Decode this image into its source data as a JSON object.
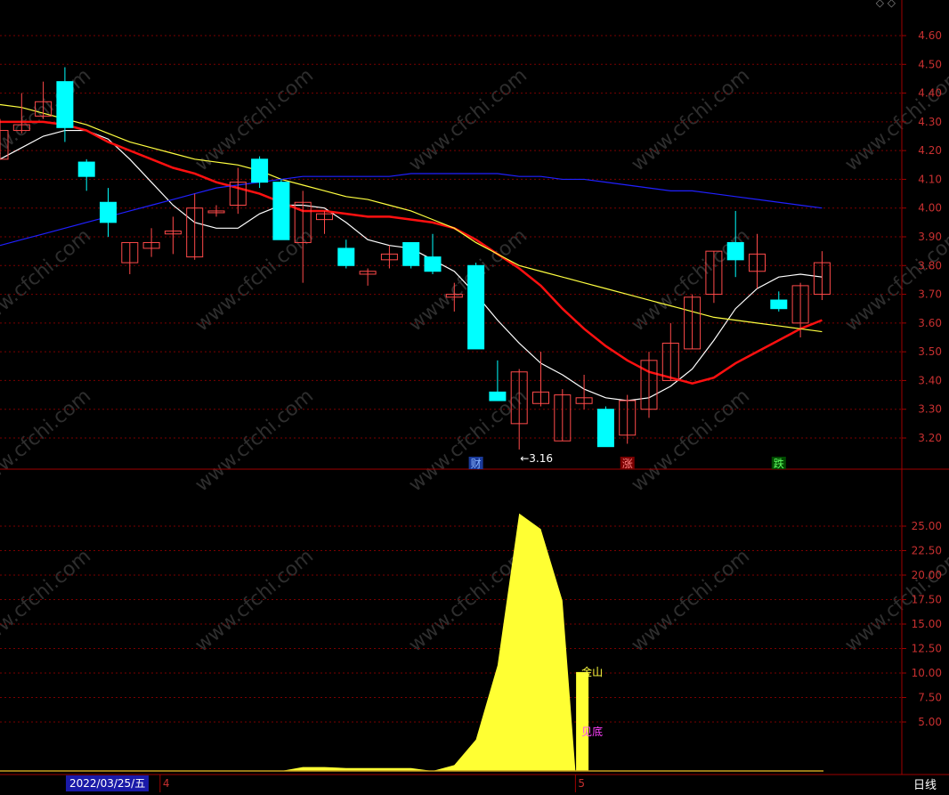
{
  "colors": {
    "background": "#000000",
    "grid": "#7a0000",
    "axis": "#a00000",
    "axis_text": "#c83030",
    "up_candle": "#ff4a4a",
    "down_candle": "#00ffff",
    "ma_white": "#ffffff",
    "ma_red": "#ff1010",
    "ma_yellow": "#ffff40",
    "ma_blue": "#2020ff",
    "indicator_fill": "#ffff33",
    "watermark": "#333333"
  },
  "watermark_text": "www.cfchi.com",
  "period_label": "日线",
  "date_badge": "2022/03/25/五",
  "top_icons": "◇ ◇",
  "chart_data": [
    {
      "type": "candlestick",
      "ylim": [
        3.08,
        4.68
      ],
      "y_ticks": [
        "4.60",
        "4.50",
        "4.40",
        "4.30",
        "4.20",
        "4.10",
        "4.00",
        "3.90",
        "3.80",
        "3.70",
        "3.60",
        "3.50",
        "3.40",
        "3.30",
        "3.20"
      ],
      "grid": true,
      "candles": [
        {
          "o": 4.17,
          "c": 4.27,
          "h": 4.31,
          "l": 4.17
        },
        {
          "o": 4.27,
          "c": 4.29,
          "h": 4.4,
          "l": 4.26
        },
        {
          "o": 4.32,
          "c": 4.37,
          "h": 4.44,
          "l": 4.31
        },
        {
          "o": 4.44,
          "c": 4.28,
          "h": 4.49,
          "l": 4.23
        },
        {
          "o": 4.16,
          "c": 4.11,
          "h": 4.17,
          "l": 4.06
        },
        {
          "o": 4.02,
          "c": 3.95,
          "h": 4.07,
          "l": 3.9
        },
        {
          "o": 3.81,
          "c": 3.88,
          "h": 3.88,
          "l": 3.77
        },
        {
          "o": 3.86,
          "c": 3.88,
          "h": 3.93,
          "l": 3.83
        },
        {
          "o": 3.91,
          "c": 3.92,
          "h": 3.97,
          "l": 3.84
        },
        {
          "o": 3.83,
          "c": 4.0,
          "h": 4.05,
          "l": 3.82
        },
        {
          "o": 3.99,
          "c": 3.99,
          "h": 4.01,
          "l": 3.97
        },
        {
          "o": 4.01,
          "c": 4.09,
          "h": 4.14,
          "l": 3.98
        },
        {
          "o": 4.17,
          "c": 4.09,
          "h": 4.18,
          "l": 4.07
        },
        {
          "o": 4.09,
          "c": 3.89,
          "h": 4.1,
          "l": 3.89
        },
        {
          "o": 3.88,
          "c": 4.02,
          "h": 4.06,
          "l": 3.74
        },
        {
          "o": 3.96,
          "c": 3.98,
          "h": 3.99,
          "l": 3.91
        },
        {
          "o": 3.86,
          "c": 3.8,
          "h": 3.89,
          "l": 3.79
        },
        {
          "o": 3.77,
          "c": 3.78,
          "h": 3.79,
          "l": 3.73
        },
        {
          "o": 3.82,
          "c": 3.84,
          "h": 3.87,
          "l": 3.79
        },
        {
          "o": 3.88,
          "c": 3.8,
          "h": 3.88,
          "l": 3.79
        },
        {
          "o": 3.83,
          "c": 3.78,
          "h": 3.91,
          "l": 3.77
        },
        {
          "o": 3.69,
          "c": 3.7,
          "h": 3.74,
          "l": 3.64
        },
        {
          "o": 3.8,
          "c": 3.51,
          "h": 3.81,
          "l": 3.51
        },
        {
          "o": 3.36,
          "c": 3.33,
          "h": 3.47,
          "l": 3.33
        },
        {
          "o": 3.25,
          "c": 3.43,
          "h": 3.44,
          "l": 3.16
        },
        {
          "o": 3.32,
          "c": 3.36,
          "h": 3.5,
          "l": 3.31
        },
        {
          "o": 3.19,
          "c": 3.35,
          "h": 3.37,
          "l": 3.19
        },
        {
          "o": 3.32,
          "c": 3.34,
          "h": 3.42,
          "l": 3.3
        },
        {
          "o": 3.3,
          "c": 3.17,
          "h": 3.31,
          "l": 3.17
        },
        {
          "o": 3.21,
          "c": 3.33,
          "h": 3.35,
          "l": 3.18
        },
        {
          "o": 3.3,
          "c": 3.47,
          "h": 3.5,
          "l": 3.27
        },
        {
          "o": 3.4,
          "c": 3.53,
          "h": 3.6,
          "l": 3.4
        },
        {
          "o": 3.51,
          "c": 3.69,
          "h": 3.7,
          "l": 3.51
        },
        {
          "o": 3.7,
          "c": 3.85,
          "h": 3.85,
          "l": 3.67
        },
        {
          "o": 3.88,
          "c": 3.82,
          "h": 3.99,
          "l": 3.76
        },
        {
          "o": 3.78,
          "c": 3.84,
          "h": 3.91,
          "l": 3.72
        },
        {
          "o": 3.68,
          "c": 3.65,
          "h": 3.71,
          "l": 3.64
        },
        {
          "o": 3.6,
          "c": 3.73,
          "h": 3.74,
          "l": 3.55
        },
        {
          "o": 3.7,
          "c": 3.81,
          "h": 3.85,
          "l": 3.68
        }
      ],
      "moving_averages": [
        {
          "color": "ma_white",
          "values": [
            4.17,
            4.21,
            4.25,
            4.27,
            4.27,
            4.24,
            4.17,
            4.09,
            4.01,
            3.95,
            3.93,
            3.93,
            3.98,
            4.01,
            4.01,
            4.0,
            3.95,
            3.89,
            3.87,
            3.86,
            3.82,
            3.78,
            3.7,
            3.61,
            3.53,
            3.46,
            3.42,
            3.37,
            3.34,
            3.33,
            3.34,
            3.38,
            3.44,
            3.54,
            3.65,
            3.72,
            3.76,
            3.77,
            3.76
          ]
        },
        {
          "color": "ma_red",
          "values": [
            4.3,
            4.3,
            4.3,
            4.29,
            4.27,
            4.23,
            4.2,
            4.17,
            4.14,
            4.12,
            4.09,
            4.07,
            4.05,
            4.02,
            3.99,
            3.99,
            3.98,
            3.97,
            3.97,
            3.96,
            3.95,
            3.93,
            3.89,
            3.84,
            3.79,
            3.73,
            3.65,
            3.58,
            3.52,
            3.47,
            3.43,
            3.41,
            3.39,
            3.41,
            3.46,
            3.5,
            3.54,
            3.58,
            3.61
          ]
        },
        {
          "color": "ma_yellow",
          "values": [
            4.36,
            4.35,
            4.33,
            4.31,
            4.29,
            4.26,
            4.23,
            4.21,
            4.19,
            4.17,
            4.16,
            4.15,
            4.13,
            4.1,
            4.08,
            4.06,
            4.04,
            4.03,
            4.01,
            3.99,
            3.96,
            3.93,
            3.88,
            3.84,
            3.8,
            3.78,
            3.76,
            3.74,
            3.72,
            3.7,
            3.68,
            3.66,
            3.64,
            3.62,
            3.61,
            3.6,
            3.59,
            3.58,
            3.57
          ]
        },
        {
          "color": "ma_blue",
          "values": [
            3.87,
            3.89,
            3.91,
            3.93,
            3.95,
            3.97,
            3.99,
            4.01,
            4.03,
            4.05,
            4.07,
            4.08,
            4.09,
            4.1,
            4.11,
            4.11,
            4.11,
            4.11,
            4.11,
            4.12,
            4.12,
            4.12,
            4.12,
            4.12,
            4.11,
            4.11,
            4.1,
            4.1,
            4.09,
            4.08,
            4.07,
            4.06,
            4.06,
            4.05,
            4.04,
            4.03,
            4.02,
            4.01,
            4.0
          ]
        }
      ],
      "annotations": [
        {
          "index": 24,
          "text": "←3.16",
          "value": 3.16
        },
        {
          "index": 22,
          "text": "财",
          "color": "#8ab4ff",
          "box": "#1a3a9a"
        },
        {
          "index": 29,
          "text": "涨",
          "color": "#ff8080",
          "box": "#7a0000"
        },
        {
          "index": 36,
          "text": "跌",
          "color": "#60ff60",
          "box": "#004a00"
        }
      ]
    },
    {
      "type": "area",
      "ylim": [
        0,
        28.5
      ],
      "y_ticks": [
        "25.00",
        "22.50",
        "20.00",
        "17.50",
        "15.00",
        "12.50",
        "10.00",
        "7.50",
        "5.00"
      ],
      "grid": true,
      "series": [
        {
          "x": 13,
          "y": 0
        },
        {
          "x": 14,
          "y": 0.4
        },
        {
          "x": 15,
          "y": 0.4
        },
        {
          "x": 16,
          "y": 0.3
        },
        {
          "x": 17,
          "y": 0.3
        },
        {
          "x": 18,
          "y": 0.3
        },
        {
          "x": 19,
          "y": 0.3
        },
        {
          "x": 20,
          "y": 0
        },
        {
          "x": 21,
          "y": 0.6
        },
        {
          "x": 22,
          "y": 3.2
        },
        {
          "x": 23,
          "y": 10.8
        },
        {
          "x": 24,
          "y": 26.3
        },
        {
          "x": 25,
          "y": 24.7
        },
        {
          "x": 26,
          "y": 17.4
        },
        {
          "x": 26.6,
          "y": 0
        }
      ],
      "bar": {
        "index": 27,
        "value": 10.1
      },
      "labels": [
        {
          "text": "金山",
          "value": 10.1,
          "color": "#ffff40"
        },
        {
          "text": "见底",
          "value": 4.0,
          "color": "#ff40ff"
        }
      ],
      "baseline": {
        "color": "#c8a020"
      }
    }
  ],
  "x_axis": {
    "month_labels": [
      {
        "text": "4",
        "index": 7.4
      },
      {
        "text": "5",
        "index": 26.6
      }
    ]
  }
}
